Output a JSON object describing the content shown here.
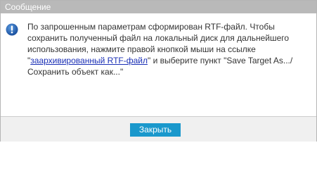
{
  "window": {
    "title": "Сообщение"
  },
  "message": {
    "icon": "info-icon",
    "text_before_link": "По запрошенным параметрам сформирован RTF-файл. Чтобы сохранить полученный файл на локальный диск для дальнейшего использования, нажмите правой кнопкой мыши на ссылке \"",
    "link_text": "заархивированный RTF-файл",
    "text_after_link": "\" и выберите пункт \"Save Target As.../Сохранить объект как...\""
  },
  "footer": {
    "close_label": "Закрыть"
  },
  "colors": {
    "titlebar": "#b9b9b9",
    "button": "#1a98cc",
    "icon": "#1f5fb0",
    "link": "#1a2fb5"
  }
}
